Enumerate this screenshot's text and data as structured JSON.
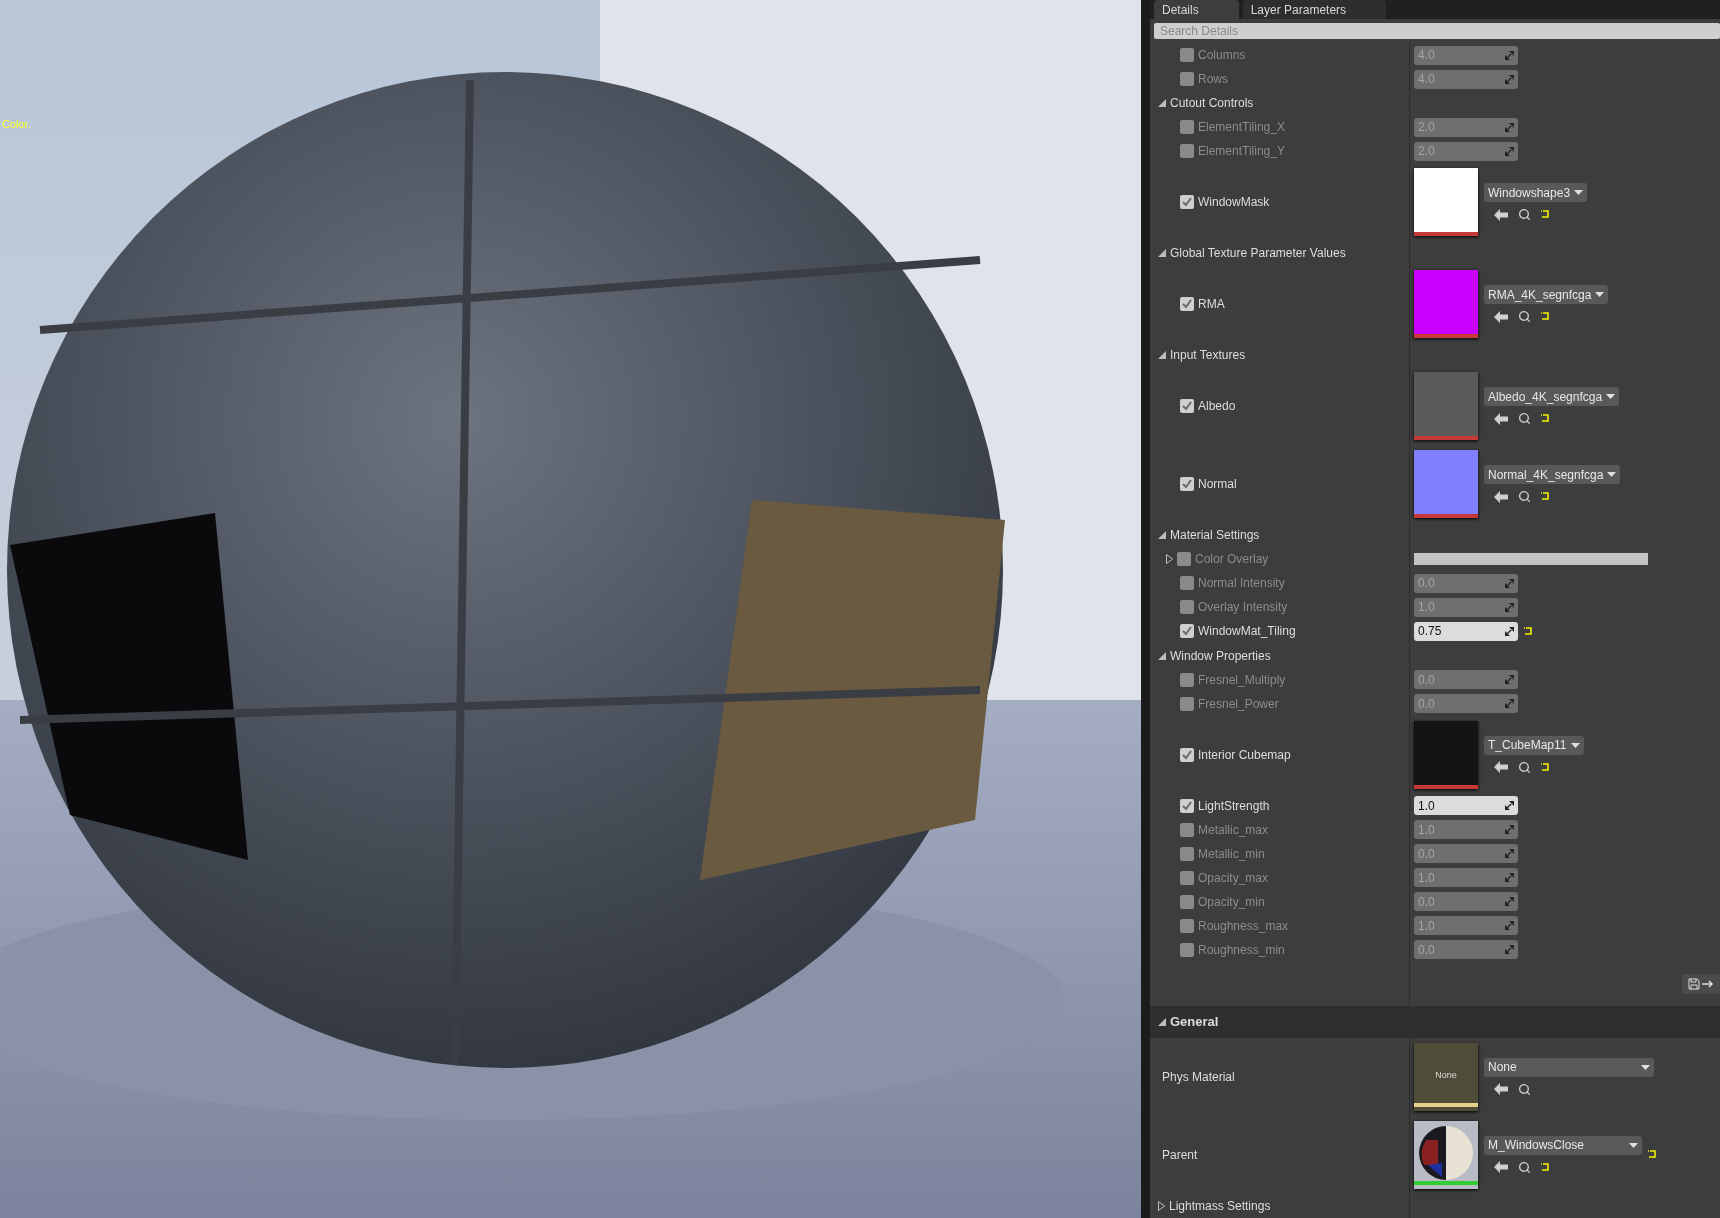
{
  "viewport": {
    "overlay_text": "Color."
  },
  "tabs": [
    {
      "label": "Details",
      "selected": true
    },
    {
      "label": "Layer Parameters",
      "selected": false
    }
  ],
  "search": {
    "placeholder": "Search Details"
  },
  "parameters": [
    {
      "kind": "scalar",
      "label": "Columns",
      "checked": false,
      "value": "4.0",
      "reset": false
    },
    {
      "kind": "scalar",
      "label": "Rows",
      "checked": false,
      "value": "4.0",
      "reset": false
    },
    {
      "kind": "section",
      "label": "Cutout Controls",
      "expanded": true
    },
    {
      "kind": "scalar",
      "label": "ElementTiling_X",
      "checked": false,
      "value": "2.0",
      "reset": false
    },
    {
      "kind": "scalar",
      "label": "ElementTiling_Y",
      "checked": false,
      "value": "2.0",
      "reset": false
    },
    {
      "kind": "texture",
      "label": "WindowMask",
      "checked": true,
      "asset": "Windowshape3",
      "color": "#ffffff",
      "reset": true
    },
    {
      "kind": "section",
      "label": "Global Texture Parameter Values",
      "expanded": true
    },
    {
      "kind": "texture",
      "label": "RMA",
      "checked": true,
      "asset": "RMA_4K_segnfcga",
      "color": "#c800ff",
      "reset": true
    },
    {
      "kind": "section",
      "label": "Input Textures",
      "expanded": true
    },
    {
      "kind": "texture",
      "label": "Albedo",
      "checked": true,
      "asset": "Albedo_4K_segnfcga",
      "color": "#5b5b59",
      "reset": true
    },
    {
      "kind": "texture",
      "label": "Normal",
      "checked": true,
      "asset": "Normal_4K_segnfcga",
      "color": "#8080ff",
      "reset": true
    },
    {
      "kind": "section",
      "label": "Material Settings",
      "expanded": true
    },
    {
      "kind": "color",
      "label": "Color Overlay",
      "checked": false,
      "expanded": false
    },
    {
      "kind": "scalar",
      "label": "Normal Intensity",
      "checked": false,
      "value": "0.0",
      "reset": false
    },
    {
      "kind": "scalar",
      "label": "Overlay Intensity",
      "checked": false,
      "value": "1.0",
      "reset": false
    },
    {
      "kind": "scalar",
      "label": "WindowMat_Tiling",
      "checked": true,
      "value": "0.75",
      "reset": true
    },
    {
      "kind": "section",
      "label": "Window Properties",
      "expanded": true
    },
    {
      "kind": "scalar",
      "label": "Fresnel_Multiply",
      "checked": false,
      "value": "0.0",
      "reset": false
    },
    {
      "kind": "scalar",
      "label": "Fresnel_Power",
      "checked": false,
      "value": "0.0",
      "reset": false
    },
    {
      "kind": "texture",
      "label": "Interior Cubemap",
      "checked": true,
      "asset": "T_CubeMap11",
      "color": "#141414",
      "reset": true
    },
    {
      "kind": "scalar",
      "label": "LightStrength",
      "checked": true,
      "value": "1.0",
      "reset": false
    },
    {
      "kind": "scalar",
      "label": "Metallic_max",
      "checked": false,
      "value": "1.0",
      "reset": false
    },
    {
      "kind": "scalar",
      "label": "Metallic_min",
      "checked": false,
      "value": "0.0",
      "reset": false
    },
    {
      "kind": "scalar",
      "label": "Opacity_max",
      "checked": false,
      "value": "1.0",
      "reset": false
    },
    {
      "kind": "scalar",
      "label": "Opacity_min",
      "checked": false,
      "value": "0.0",
      "reset": false
    },
    {
      "kind": "scalar",
      "label": "Roughness_max",
      "checked": false,
      "value": "1.0",
      "reset": false
    },
    {
      "kind": "scalar",
      "label": "Roughness_min",
      "checked": false,
      "value": "0.0",
      "reset": false
    }
  ],
  "general": {
    "title": "General",
    "expanded": true,
    "rows": [
      {
        "label": "Phys Material",
        "thumb_text": "None",
        "color": "#e6d48a",
        "asset": "None",
        "reset": false
      },
      {
        "label": "Parent",
        "color": "#33cc33",
        "asset": "M_WindowsClose",
        "reset": true
      }
    ]
  },
  "lightmass": {
    "label": "Lightmass Settings",
    "expanded": false
  }
}
